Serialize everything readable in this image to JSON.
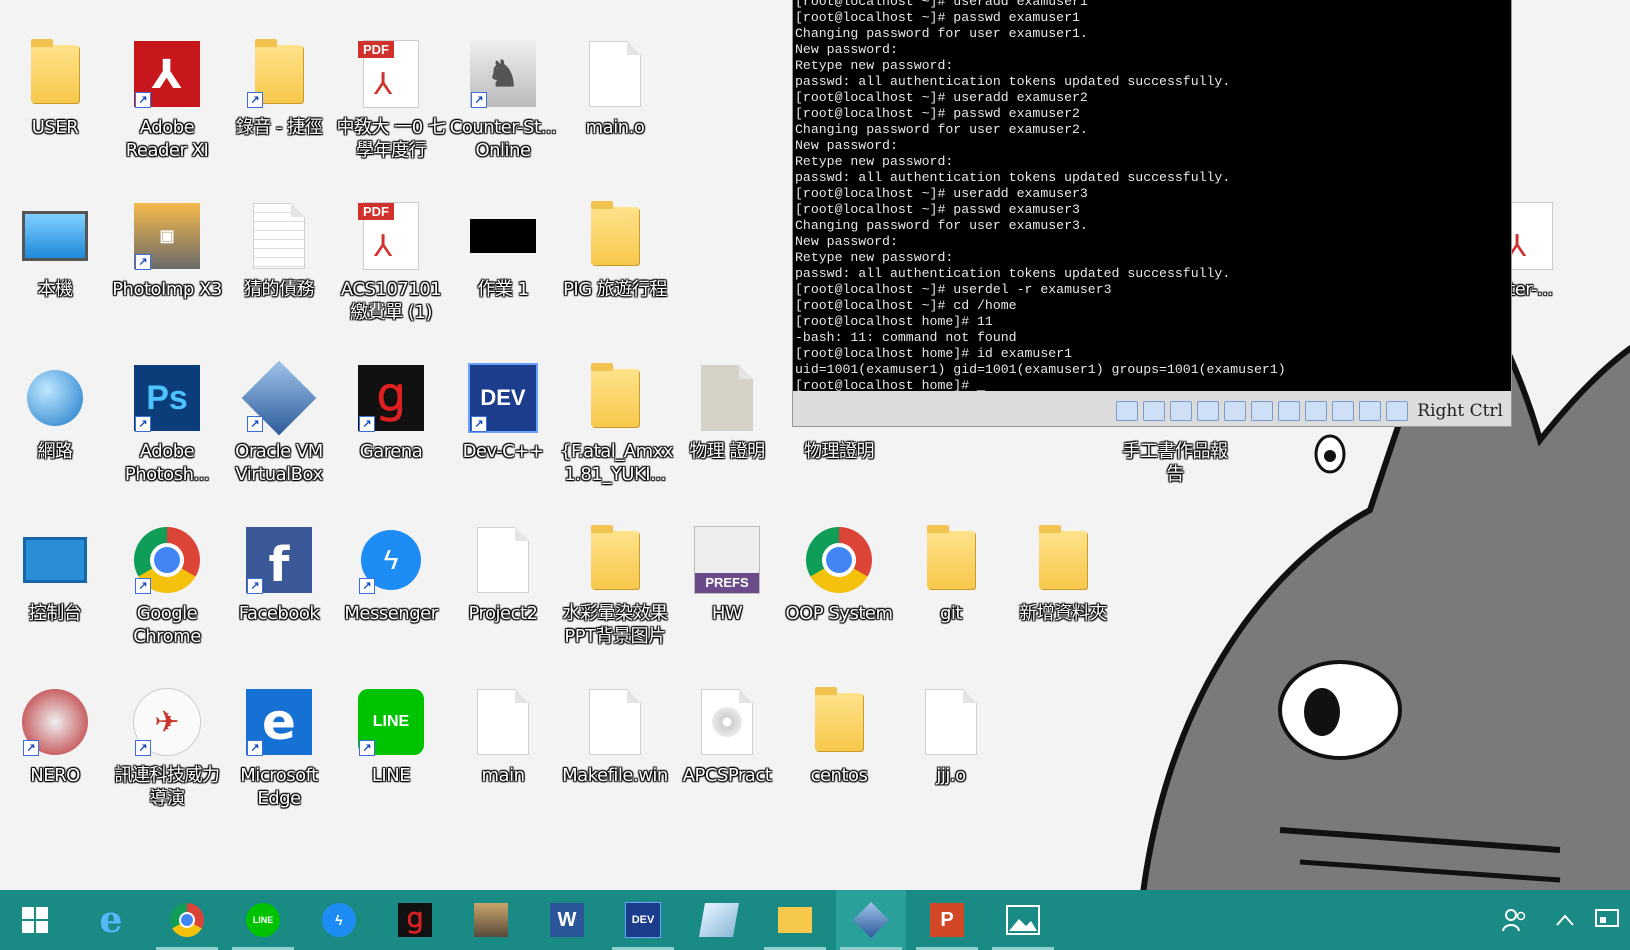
{
  "desktop": {
    "icons": [
      {
        "label": "USER"
      },
      {
        "label": "Adobe Reader XI"
      },
      {
        "label": "錄音 - 捷徑"
      },
      {
        "label": "中敎大 一0 七學年度行"
      },
      {
        "label": "Counter-St... Online"
      },
      {
        "label": "main.o"
      },
      {
        "label": "本機"
      },
      {
        "label": "PhotoImp X3"
      },
      {
        "label": "猜的債務"
      },
      {
        "label": "ACS107101 繳費單 (1)"
      },
      {
        "label": "作業 1"
      },
      {
        "label": "PIG 旅遊行程"
      },
      {
        "label": "網路"
      },
      {
        "label": "Adobe Photosh..."
      },
      {
        "label": "Oracle VM VirtualBox"
      },
      {
        "label": "Garena"
      },
      {
        "label": "Dev-C++"
      },
      {
        "label": "{F.atal_Amxx 1.81_YUKI..."
      },
      {
        "label": "物理 證明"
      },
      {
        "label": "物理證明"
      },
      {
        "label": "手工書作品報告"
      },
      {
        "label": "控制台"
      },
      {
        "label": "Google Chrome"
      },
      {
        "label": "Facebook"
      },
      {
        "label": "Messenger"
      },
      {
        "label": "Project2"
      },
      {
        "label": "水彩暈染效果 PPT背景图片"
      },
      {
        "label": "HW"
      },
      {
        "label": "OOP System"
      },
      {
        "label": "git"
      },
      {
        "label": "新增資料夾"
      },
      {
        "label": "NERO"
      },
      {
        "label": "訊連科技威力導演"
      },
      {
        "label": "Microsoft Edge"
      },
      {
        "label": "LINE"
      },
      {
        "label": "main"
      },
      {
        "label": "Makefile.win"
      },
      {
        "label": "APCSPract"
      },
      {
        "label": "centos"
      },
      {
        "label": "jjj.o"
      },
      {
        "label": "uter-..."
      }
    ]
  },
  "terminal": {
    "text": "[root@localhost ~]# useradd examuser1\n[root@localhost ~]# passwd examuser1\nChanging password for user examuser1.\nNew password:\nRetype new password:\npasswd: all authentication tokens updated successfully.\n[root@localhost ~]# useradd examuser2\n[root@localhost ~]# passwd examuser2\nChanging password for user examuser2.\nNew password:\nRetype new password:\npasswd: all authentication tokens updated successfully.\n[root@localhost ~]# useradd examuser3\n[root@localhost ~]# passwd examuser3\nChanging password for user examuser3.\nNew password:\nRetype new password:\npasswd: all authentication tokens updated successfully.\n[root@localhost ~]# userdel -r examuser3\n[root@localhost ~]# cd /home\n[root@localhost home]# 11\n-bash: 11: command not found\n[root@localhost home]# id examuser1\nuid=1001(examuser1) gid=1001(examuser1) groups=1001(examuser1)\n[root@localhost home]# _",
    "host_key": "Right Ctrl"
  },
  "taskbar": {
    "edge": "e",
    "line": "LINE",
    "dev": "DEV",
    "word": "W",
    "ppt": "P"
  },
  "colors": {
    "taskbar": "#1a8a85",
    "terminal_bg": "#000000"
  }
}
